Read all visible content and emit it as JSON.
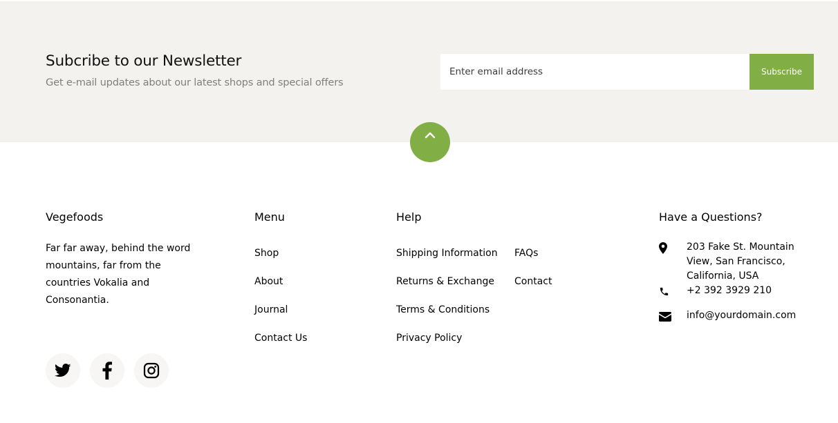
{
  "newsletter": {
    "title": "Subcribe to our Newsletter",
    "subtitle": "Get e-mail updates about our latest shops and special offers",
    "email_placeholder": "Enter email address",
    "subscribe_label": "Subscribe"
  },
  "colors": {
    "accent": "#82ae46",
    "newsletter_bg": "#f4f2ee"
  },
  "scroll_top": {
    "icon": "chevron-up-icon"
  },
  "footer": {
    "brand": {
      "title": "Vegefoods",
      "description": "Far far away, behind the word mountains, far from the countries Vokalia and Consonantia.",
      "social": [
        {
          "name": "twitter-icon"
        },
        {
          "name": "facebook-icon"
        },
        {
          "name": "instagram-icon"
        }
      ]
    },
    "menu": {
      "title": "Menu",
      "items": [
        "Shop",
        "About",
        "Journal",
        "Contact Us"
      ]
    },
    "help": {
      "title": "Help",
      "col1": [
        "Shipping Information",
        "Returns & Exchange",
        "Terms & Conditions",
        "Privacy Policy"
      ],
      "col2": [
        "FAQs",
        "Contact"
      ]
    },
    "contact": {
      "title": "Have a Questions?",
      "address": "203 Fake St. Mountain View, San Francisco, California, USA",
      "phone": "+2 392 3929 210",
      "email": "info@yourdomain.com"
    }
  }
}
